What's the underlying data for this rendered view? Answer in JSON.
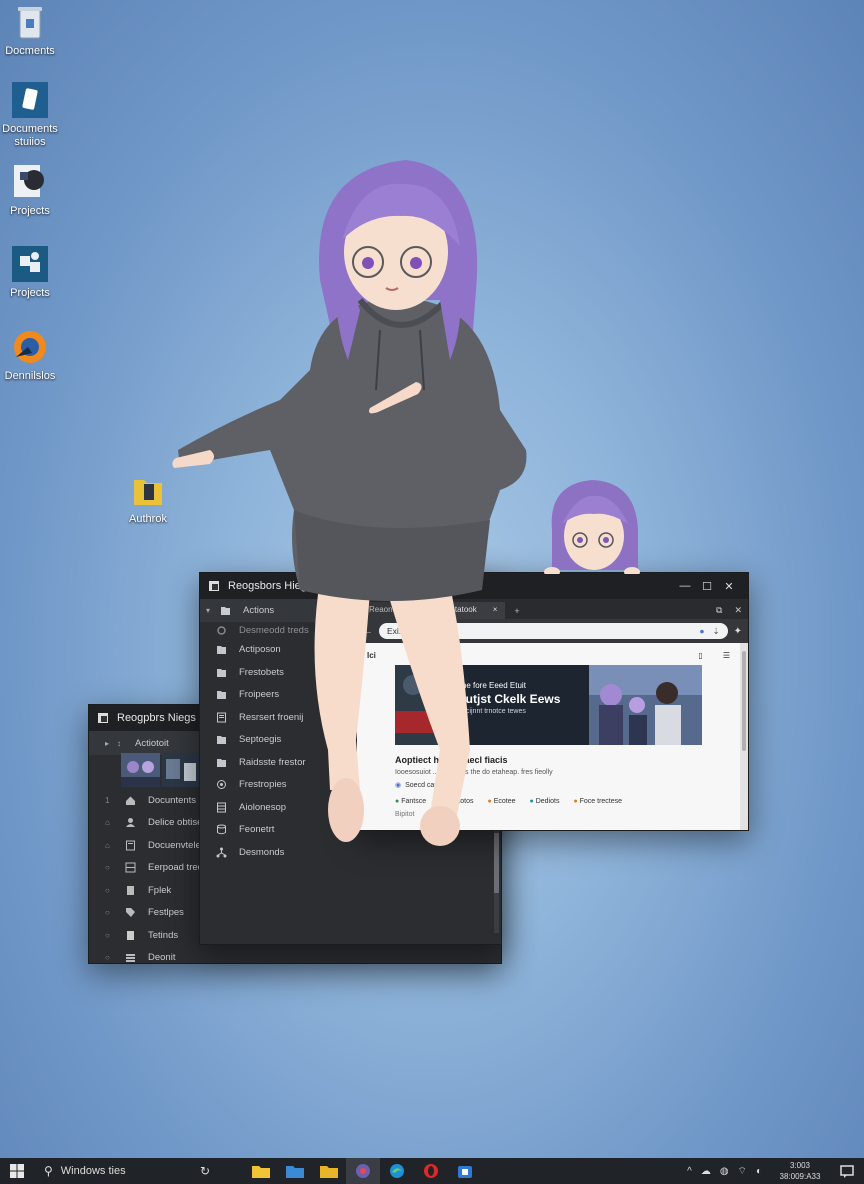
{
  "desktop": {
    "icons": [
      {
        "label": "Docments",
        "icon": "recycle-bin-icon"
      },
      {
        "label": "Documents stuiios",
        "icon": "phone-app-icon"
      },
      {
        "label": "Projects",
        "icon": "projects-icon"
      },
      {
        "label": "Projects",
        "icon": "puzzle-icon"
      },
      {
        "label": "Dennilslos",
        "icon": "browser-globe-icon"
      },
      {
        "label": "Authrok",
        "icon": "folder-icon"
      }
    ]
  },
  "back_window": {
    "title": "Reogpbrs Niegs",
    "header": "Actiotoit",
    "items": [
      {
        "n": "1",
        "label": "Docuntents"
      },
      {
        "n": "",
        "label": "Delice obtisesen"
      },
      {
        "n": "",
        "label": "Docuenvteleeso"
      },
      {
        "n": "",
        "label": "Eerpoad treck"
      },
      {
        "n": "",
        "label": "Fplek"
      },
      {
        "n": "",
        "label": "Festlpes"
      },
      {
        "n": "",
        "label": "Tetinds"
      },
      {
        "n": "",
        "label": "Deonit"
      }
    ]
  },
  "explorer": {
    "title": "Reogsbors Hiegs",
    "header": "Actions",
    "items": [
      {
        "label": "Desmeodd treds",
        "icon": "gear-icon"
      },
      {
        "label": "Actiposon",
        "icon": "folder-icon"
      },
      {
        "label": "Frestobets",
        "icon": "folder-icon"
      },
      {
        "label": "Froipeers",
        "icon": "folder-icon"
      },
      {
        "label": "Resrsert froenij",
        "icon": "document-icon"
      },
      {
        "label": "Septoegis",
        "icon": "folder-icon"
      },
      {
        "label": "Raidsste frestor",
        "icon": "folder-icon"
      },
      {
        "label": "Frestropies",
        "icon": "settings-icon"
      },
      {
        "label": "Aiolonesop",
        "icon": "grid-icon"
      },
      {
        "label": "Feonetrt",
        "icon": "database-icon"
      },
      {
        "label": "Desmonds",
        "icon": "network-icon"
      }
    ]
  },
  "browser": {
    "tabs": [
      "Reaone",
      "3 Irrstatook"
    ],
    "address": "Exi... ieegsstegcle",
    "page_top_left": "Ici",
    "page_top_center": "ttrecde",
    "banner": {
      "line1": "Tne fore Eeed Etuit",
      "line2": "Cutjst Ckelk Eews",
      "line3": "Decijnnt trnotce tewes",
      "left_badge": "..."
    },
    "headline": "Aoptiect ha... nsaecl fiacis",
    "subline": "Iooesosuiot ... ecladhes the do etaheap. fres fieolly",
    "link": "Soecd car",
    "chips": [
      {
        "label": "Fantsce",
        "color": "#2e8b57"
      },
      {
        "label": "Eastotos",
        "color": "#2e8b57"
      },
      {
        "label": "Ecotee",
        "color": "#e07a1f"
      },
      {
        "label": "Dediots",
        "color": "#1c8fa6"
      },
      {
        "label": "Foce trectese",
        "color": "#e07a1f"
      }
    ],
    "footer": "Bipitot"
  },
  "taskbar": {
    "search_placeholder": "Windows ties",
    "clock_time": "3:003",
    "clock_date": "38:009:A33"
  }
}
